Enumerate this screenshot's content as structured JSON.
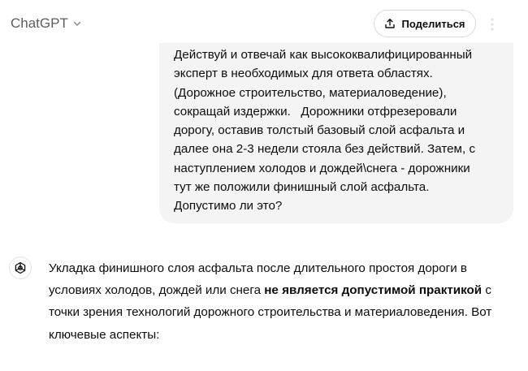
{
  "header": {
    "model_name": "ChatGPT",
    "share_label": "Поделиться",
    "icons": {
      "model": "chevron-down-icon",
      "share": "share-upload-icon",
      "menu": "more-vertical-icon"
    }
  },
  "conversation": {
    "user_message": {
      "lines": [
        "Действуй и отвечай как высококвалифицированный",
        "эксперт в необходимых для ответа областях.",
        "(Дорожное строительство, материаловедение),",
        "сокращай издержки.   Дорожники отфрезеровали",
        "дорогу, оставив толстый базовый слой асфальта и",
        "далее она 2-3 недели стояла без действий. Затем, с",
        "наступлением холодов и дождей\\снега - дорожники",
        "тут же положили финишный слой асфальта.",
        "Допустимо ли это?"
      ]
    },
    "assistant_message": {
      "avatar_icon": "openai-logo-icon",
      "line1": "Укладка финишного слоя асфальта после длительного простоя дороги в",
      "line2_pre": "условиях холодов, дождей или снега ",
      "line2_bold": "не является допустимой практикой",
      "line2_post": " с",
      "line3": "точки зрения технологий дорожного строительства и материаловедения. Вот",
      "line4": "ключевые аспекты:"
    }
  }
}
